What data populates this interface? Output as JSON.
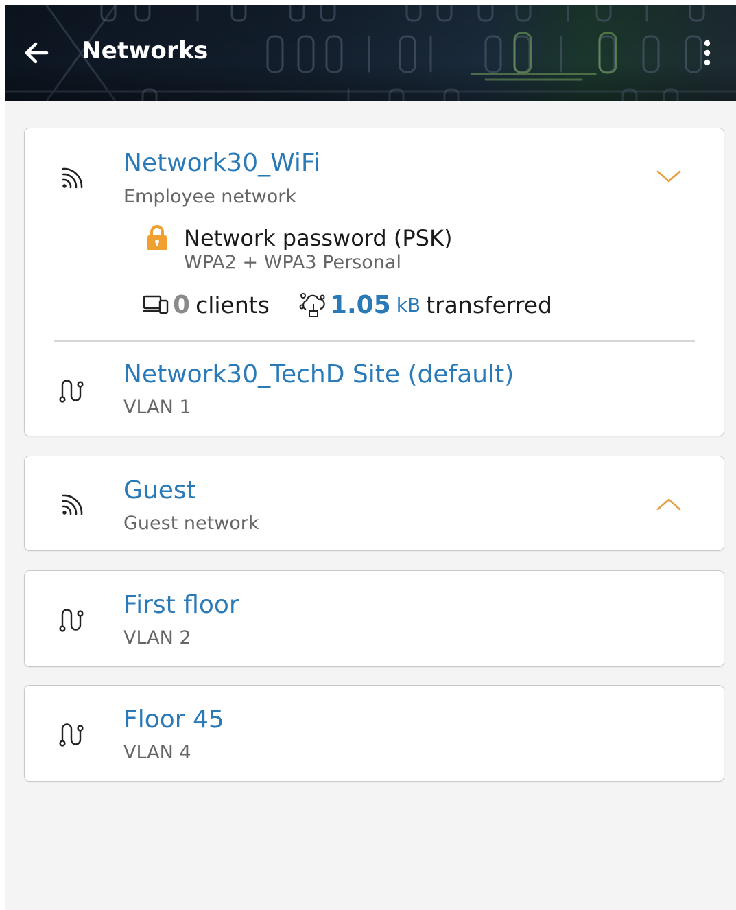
{
  "appbar": {
    "title": "Networks",
    "back_icon": "arrow-left-icon",
    "menu_icon": "more-vertical-icon"
  },
  "colors": {
    "accent_blue": "#2a7ab8",
    "chevron_orange": "#e8a14a",
    "lock_orange": "#f0a030",
    "subtext_gray": "#666666",
    "card_border": "#c9c9c9"
  },
  "wifi_network": {
    "name": "Network30_WiFi",
    "type": "Employee network",
    "icon": "wifi-signal-icon",
    "expanded": true,
    "security": {
      "icon": "lock-icon",
      "title": "Network password (PSK)",
      "subtitle": "WPA2 + WPA3 Personal"
    },
    "stats": {
      "clients_icon": "devices-icon",
      "clients_count": "0",
      "clients_label": "clients",
      "transfer_icon": "data-transfer-icon",
      "transfer_value": "1.05",
      "transfer_unit": "kB",
      "transfer_label": "transferred"
    },
    "vlan": {
      "icon": "vlan-cable-icon",
      "name": "Network30_TechD Site (default)",
      "subtitle": "VLAN 1"
    }
  },
  "guest_network": {
    "name": "Guest",
    "type": "Guest network",
    "icon": "wifi-signal-icon",
    "expanded": false
  },
  "vlans": [
    {
      "icon": "vlan-cable-icon",
      "name": "First floor",
      "subtitle": "VLAN 2"
    },
    {
      "icon": "vlan-cable-icon",
      "name": "Floor 45",
      "subtitle": "VLAN 4"
    }
  ]
}
